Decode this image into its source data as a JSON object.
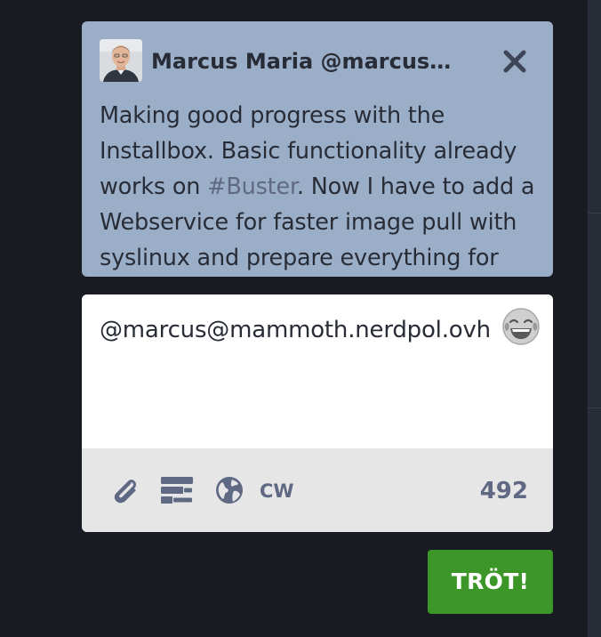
{
  "reply": {
    "display_name": "Marcus Maria @marcus@…",
    "text_before": "Making good progress with the Installbox. Basic functionality already works on ",
    "hashtag": "#Buster",
    "text_after": ". Now I have to add a Webservice for faster image pull with syslinux and prepare everything for"
  },
  "compose": {
    "text": "@marcus@mammoth.nerdpol.ovh",
    "cw_label": "CW",
    "char_count": "492"
  },
  "submit": {
    "label": "TRÖT!"
  },
  "icons": {
    "close": "close-icon",
    "emoji": "emoji-tears-of-joy-icon",
    "attach": "paperclip-icon",
    "poll": "poll-icon",
    "visibility": "globe-icon"
  },
  "colors": {
    "background": "#191b22",
    "reply_bg": "#9baec8",
    "toolbar_bg": "#e6e6e6",
    "accent_text": "#606984",
    "submit_bg": "#3d9728"
  }
}
